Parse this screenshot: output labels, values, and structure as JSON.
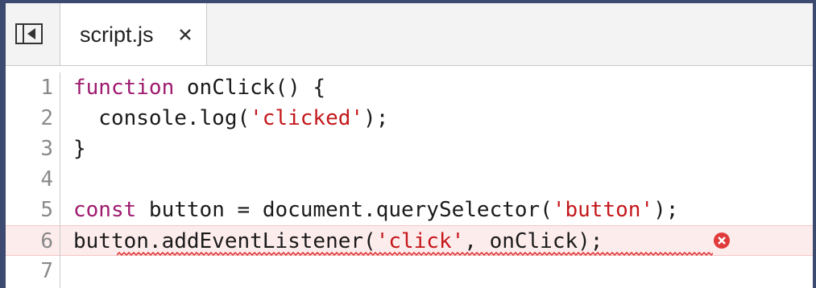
{
  "tab": {
    "filename": "script.js",
    "close_glyph": "×"
  },
  "sidebar_toggle": {
    "icon": "sidebar-collapse-icon"
  },
  "editor": {
    "lines": [
      {
        "number": "1",
        "tokens": [
          {
            "text": "function",
            "kind": "keyword"
          },
          {
            "text": " onClick() {",
            "kind": "plain"
          }
        ]
      },
      {
        "number": "2",
        "tokens": [
          {
            "text": "  console.log(",
            "kind": "plain"
          },
          {
            "text": "'clicked'",
            "kind": "string"
          },
          {
            "text": ");",
            "kind": "plain"
          }
        ]
      },
      {
        "number": "3",
        "tokens": [
          {
            "text": "}",
            "kind": "plain"
          }
        ]
      },
      {
        "number": "4",
        "tokens": []
      },
      {
        "number": "5",
        "tokens": [
          {
            "text": "const",
            "kind": "keyword"
          },
          {
            "text": " button = document.querySelector(",
            "kind": "plain"
          },
          {
            "text": "'button'",
            "kind": "string"
          },
          {
            "text": ");",
            "kind": "plain"
          }
        ]
      },
      {
        "number": "6",
        "tokens": [
          {
            "text": "button.addEventListener(",
            "kind": "plain"
          },
          {
            "text": "'click'",
            "kind": "string"
          },
          {
            "text": ", onClick);",
            "kind": "plain"
          }
        ]
      },
      {
        "number": "7",
        "tokens": []
      }
    ],
    "error_line": "6",
    "error_icon": "error-x-icon"
  },
  "colors": {
    "keyword": "#9e1a6e",
    "string": "#c4171b",
    "error_background": "#fdecec",
    "error_icon": "#e03a3a",
    "window_frame": "#3b4a6e"
  }
}
